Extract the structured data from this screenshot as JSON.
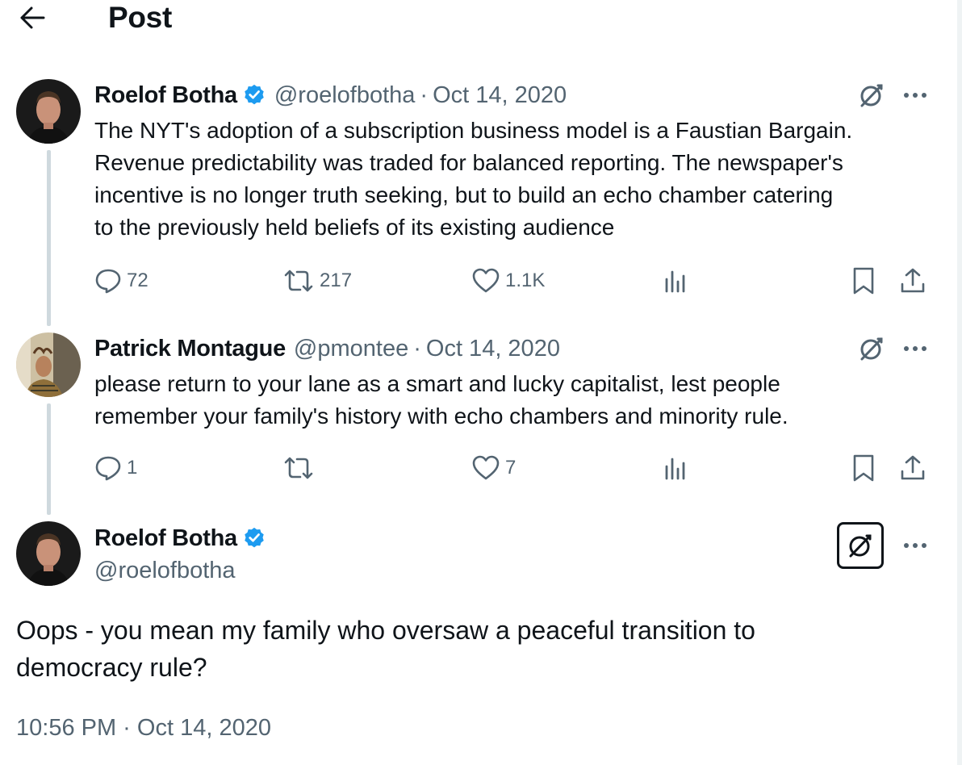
{
  "header": {
    "title": "Post",
    "back_icon": "arrow-left-icon"
  },
  "colors": {
    "text_primary": "#0f1419",
    "text_secondary": "#536471",
    "verified_blue": "#1d9bf0",
    "thread_line": "#cfd9de"
  },
  "thread": [
    {
      "display_name": "Roelof Botha",
      "verified": true,
      "handle": "@roelofbotha",
      "separator": "·",
      "date": "Oct 14, 2020",
      "text_lines": [
        "The NYT's adoption of a subscription business model is a Faustian Bargain.",
        "Revenue predictability was traded for balanced reporting. The newspaper's",
        "incentive is no longer truth seeking, but to build an echo chamber catering",
        "to the previously held beliefs of its existing audience"
      ],
      "replies": "72",
      "reposts": "217",
      "likes": "1.1K"
    },
    {
      "display_name": "Patrick Montague",
      "verified": false,
      "handle": "@pmontee",
      "separator": "·",
      "date": "Oct 14, 2020",
      "text_lines": [
        "please return to your lane as a smart and lucky capitalist, lest people",
        "remember your family's history with echo chambers and minority rule."
      ],
      "replies": "1",
      "reposts": "",
      "likes": "7"
    }
  ],
  "main_post": {
    "display_name": "Roelof Botha",
    "verified": true,
    "handle": "@roelofbotha",
    "text_lines": [
      "Oops - you mean my family who oversaw a peaceful transition to",
      "democracy rule?"
    ],
    "timestamp": "10:56 PM · Oct 14, 2020"
  }
}
